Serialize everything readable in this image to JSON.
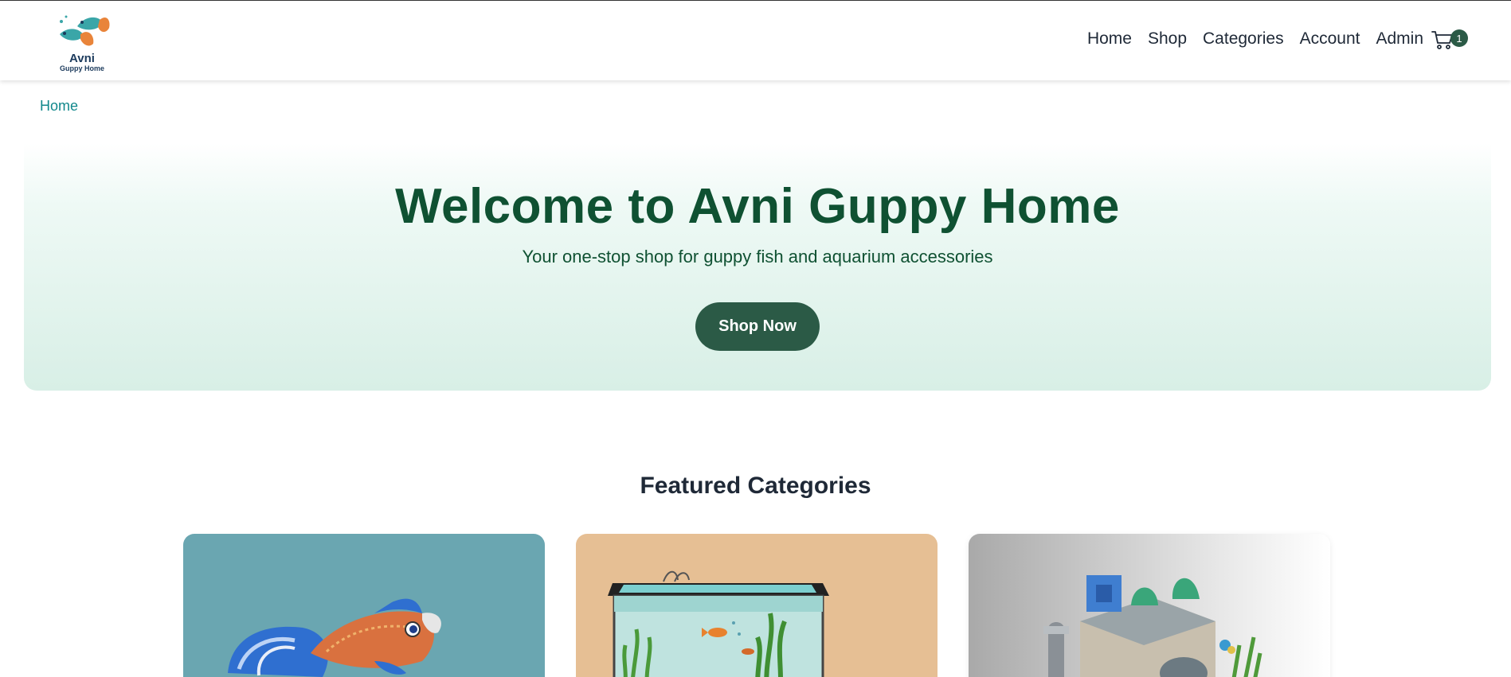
{
  "brand": {
    "name": "Avni",
    "tagline": "Guppy Home"
  },
  "nav": {
    "links": [
      {
        "label": "Home"
      },
      {
        "label": "Shop"
      },
      {
        "label": "Categories"
      },
      {
        "label": "Account"
      },
      {
        "label": "Admin"
      }
    ],
    "cart_icon": "cart-icon",
    "cart_count": "1"
  },
  "breadcrumb": {
    "home": "Home"
  },
  "hero": {
    "title": "Welcome to Avni Guppy Home",
    "subtitle": "Your one-stop shop for guppy fish and aquarium accessories",
    "cta_label": "Shop Now"
  },
  "featured": {
    "title": "Featured Categories"
  },
  "colors": {
    "primary": "#2b5a46",
    "hero_text": "#0f5132",
    "breadcrumb": "#12888c",
    "card_fish_bg": "#6aa6b1",
    "card_tank_bg": "#e6bf94"
  }
}
